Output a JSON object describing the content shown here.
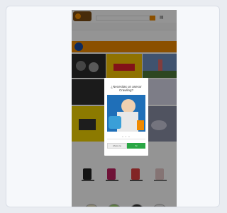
{
  "header": {
    "top_links": "",
    "nav_items": [],
    "promo_text": ""
  },
  "banner": {
    "text": ""
  },
  "sections": {
    "products_title": "",
    "products": [],
    "bottom_title": ""
  },
  "modal": {
    "title": "¿Necesitas un asesor Crawling?",
    "no_label": "Ahora no",
    "yes_label": "Sí",
    "image_alt": "customer service with inline skates"
  },
  "colors": {
    "accent": "#f08a00",
    "brand_blue": "#1a4aa0",
    "confirm_green": "#2aa745",
    "overlay": "rgba(0,0,0,0.42)"
  }
}
